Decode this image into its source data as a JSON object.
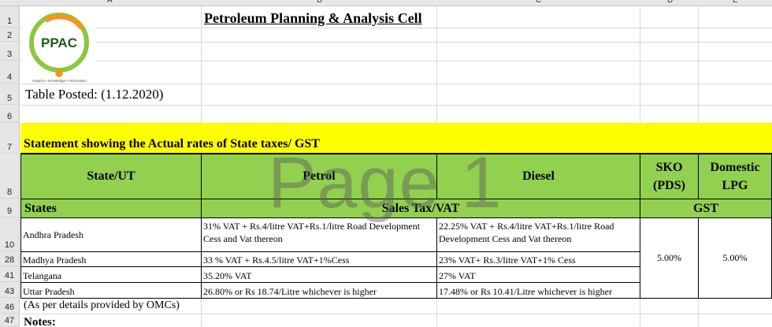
{
  "columns": [
    "A",
    "B",
    "C",
    "D",
    "E"
  ],
  "rows": [
    "1",
    "2",
    "3",
    "4",
    "5",
    "6",
    "7",
    "8",
    "9",
    "10",
    "28",
    "41",
    "43",
    "46",
    "47"
  ],
  "logo": {
    "text": "PPAC",
    "tagline": "Analysis • Knowledge • Information"
  },
  "title": "Petroleum Planning & Analysis Cell",
  "posted": "Table Posted: (1.12.2020)",
  "banner": "Statement showing the Actual rates of State taxes/ GST",
  "headers": {
    "state": "State/UT",
    "petrol": "Petrol",
    "diesel": "Diesel",
    "sko": "SKO (PDS)",
    "lpg": "Domestic LPG"
  },
  "subheaders": {
    "states": "States",
    "vat": "Sales Tax/VAT",
    "gst": "GST"
  },
  "table_rows": [
    {
      "state": "Andhra Pradesh",
      "petrol": "31% VAT + Rs.4/litre VAT+Rs.1/litre Road Development Cess and Vat thereon",
      "diesel": "22.25% VAT + Rs.4/litre VAT+Rs.1/litre Road Development Cess and Vat thereon"
    },
    {
      "state": "Madhya Pradesh",
      "petrol": "33 % VAT + Rs.4.5/litre VAT+1%Cess",
      "diesel": "23% VAT+ Rs.3/litre VAT+1% Cess"
    },
    {
      "state": "Telangana",
      "petrol": "35.20% VAT",
      "diesel": "27% VAT"
    },
    {
      "state": "Uttar Pradesh",
      "petrol": "26.80% or Rs 18.74/Litre whichever is higher",
      "diesel": "17.48% or Rs 10.41/Litre whichever is higher"
    }
  ],
  "sko_gst": "5.00%",
  "lpg_gst": "5.00%",
  "footnote": "(As per details provided by OMCs)",
  "notes_label": "Notes:",
  "watermark": "Page 1",
  "colors": {
    "banner": "#ffff00",
    "header": "#92d050",
    "logo_green": "#8dc63f",
    "logo_orange": "#f7941d"
  }
}
